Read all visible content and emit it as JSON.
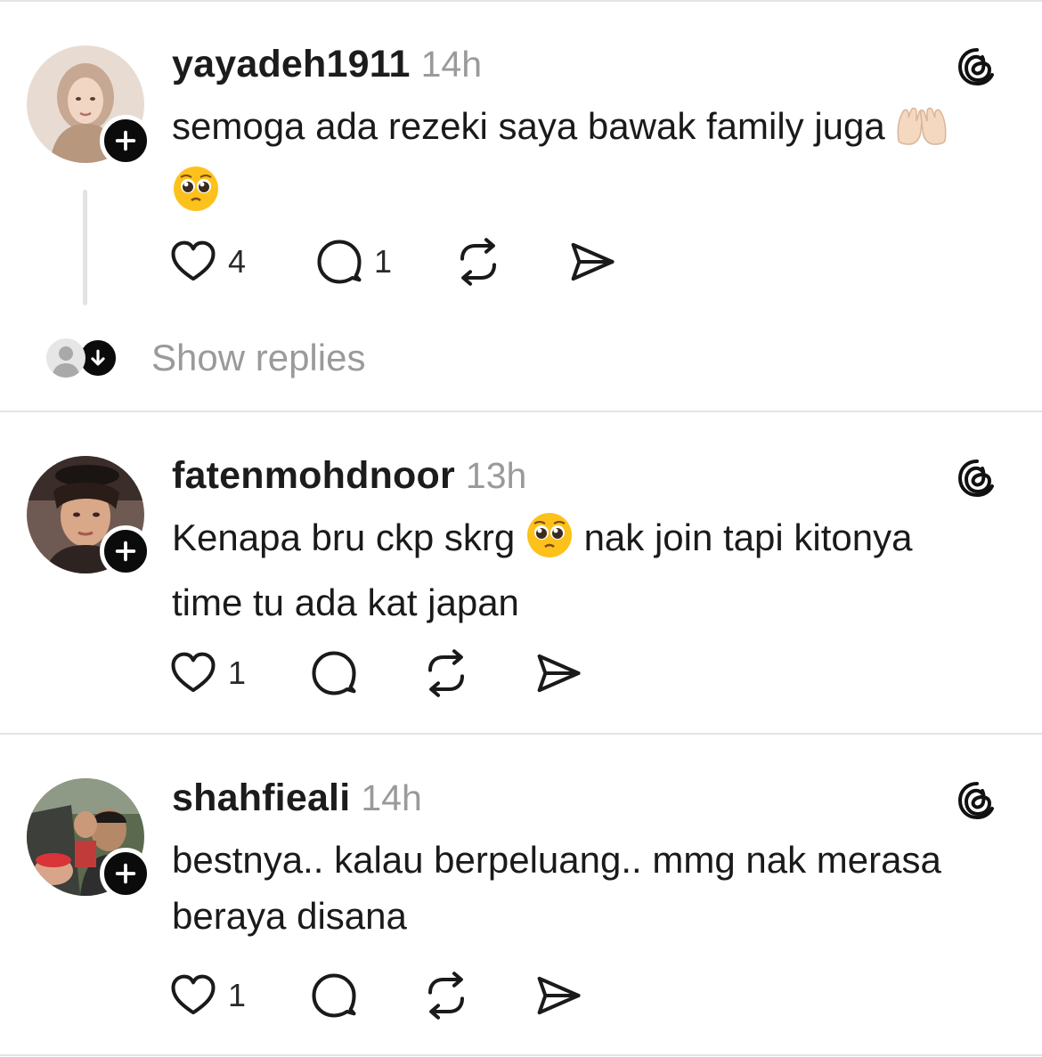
{
  "posts": [
    {
      "username": "yayadeh1911",
      "time": "14h",
      "text_line1": "semoga ada rezeki saya bawak family juga",
      "likes": "4",
      "replies": "1",
      "show_replies_label": "Show replies"
    },
    {
      "username": "fatenmohdnoor",
      "time": "13h",
      "text_part1": "Kenapa bru ckp skrg",
      "text_part2": "nak join tapi kitonya",
      "text_line2": "time tu ada kat japan",
      "likes": "1"
    },
    {
      "username": "shahfieali",
      "time": "14h",
      "text_line1": "bestnya.. kalau berpeluang.. mmg nak merasa",
      "text_line2": "beraya disana",
      "likes": "1"
    }
  ],
  "icons": {
    "like": "heart-icon",
    "reply": "comment-icon",
    "repost": "repost-icon",
    "share": "send-icon",
    "brand": "threads-icon",
    "follow": "plus-icon"
  },
  "colors": {
    "text": "#1a1a1a",
    "muted": "#9a9a9a",
    "badge": "#0b0b0b",
    "separator": "#e3e3e3"
  }
}
